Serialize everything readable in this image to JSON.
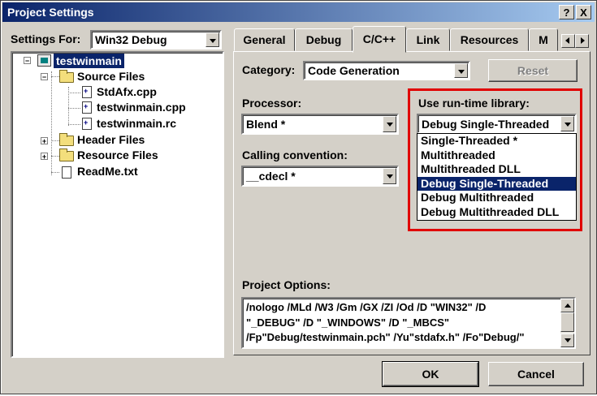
{
  "window": {
    "title": "Project Settings",
    "help_label": "?",
    "close_label": "X"
  },
  "settings_for": {
    "label": "Settings For:",
    "value": "Win32 Debug"
  },
  "tree": {
    "project": "testwinmain",
    "source_folder": "Source Files",
    "source_files": [
      "StdAfx.cpp",
      "testwinmain.cpp",
      "testwinmain.rc"
    ],
    "header_folder": "Header Files",
    "resource_folder": "Resource Files",
    "readme": "ReadMe.txt",
    "expanded_glyph": "−",
    "collapsed_glyph": "+"
  },
  "tabs": [
    {
      "label": "General"
    },
    {
      "label": "Debug"
    },
    {
      "label": "C/C++"
    },
    {
      "label": "Link"
    },
    {
      "label": "Resources"
    },
    {
      "label": "M"
    }
  ],
  "active_tab": "C/C++",
  "category": {
    "label": "Category:",
    "value": "Code Generation"
  },
  "reset_button": "Reset",
  "processor": {
    "label": "Processor:",
    "value": "Blend *"
  },
  "calling_convention": {
    "label": "Calling convention:",
    "value": "__cdecl *"
  },
  "runtime_library": {
    "label": "Use run-time library:",
    "value": "Debug Single-Threaded",
    "options": [
      "Single-Threaded *",
      "Multithreaded",
      "Multithreaded DLL",
      "Debug Single-Threaded",
      "Debug Multithreaded",
      "Debug Multithreaded DLL"
    ],
    "selected_index": 3
  },
  "project_options": {
    "label": "Project Options:",
    "lines": [
      "/nologo /MLd /W3 /Gm /GX /ZI /Od /D \"WIN32\" /D",
      "\"_DEBUG\" /D \"_WINDOWS\" /D \"_MBCS\"",
      "/Fp\"Debug/testwinmain.pch\" /Yu\"stdafx.h\" /Fo\"Debug/\""
    ]
  },
  "buttons": {
    "ok": "OK",
    "cancel": "Cancel"
  },
  "colors": {
    "highlight": "#0a246a",
    "annotation_box": "#e00000",
    "dialog_face": "#d4d0c8"
  }
}
